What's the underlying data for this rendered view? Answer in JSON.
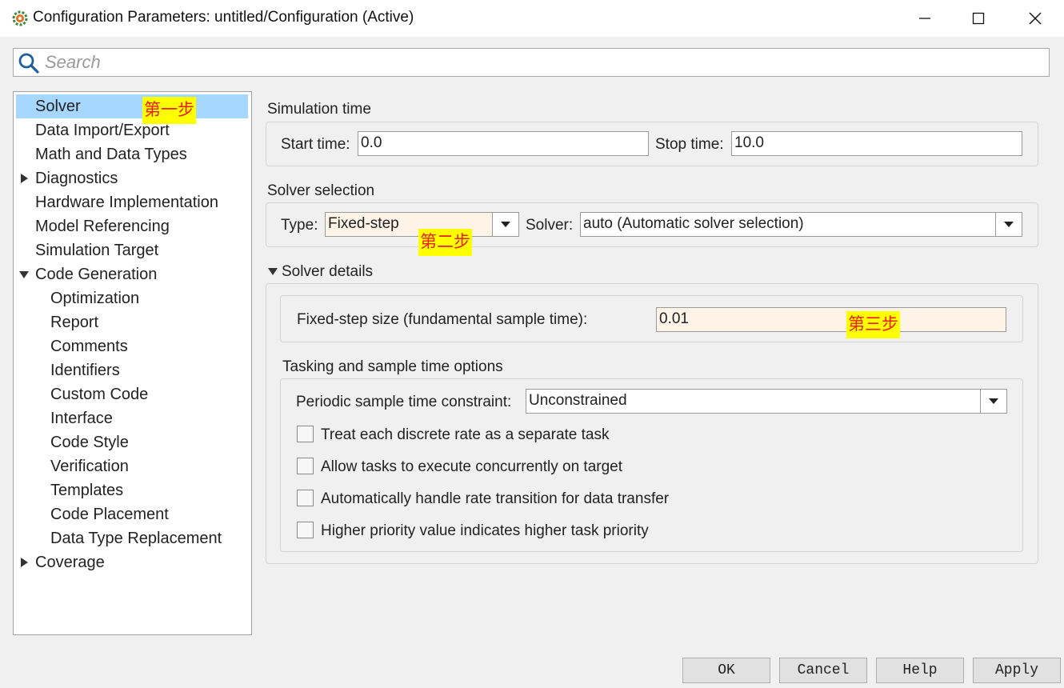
{
  "window": {
    "title": "Configuration Parameters: untitled/Configuration (Active)",
    "icon": "gear-cog-icon"
  },
  "search": {
    "placeholder": "Search",
    "value": ""
  },
  "tree": {
    "items": [
      {
        "label": "Solver",
        "selected": true
      },
      {
        "label": "Data Import/Export"
      },
      {
        "label": "Math and Data Types"
      },
      {
        "label": "Diagnostics",
        "expander": "collapsed"
      },
      {
        "label": "Hardware Implementation"
      },
      {
        "label": "Model Referencing"
      },
      {
        "label": "Simulation Target"
      },
      {
        "label": "Code Generation",
        "expander": "expanded"
      },
      {
        "label": "Optimization"
      },
      {
        "label": "Report"
      },
      {
        "label": "Comments"
      },
      {
        "label": "Identifiers"
      },
      {
        "label": "Custom Code"
      },
      {
        "label": "Interface"
      },
      {
        "label": "Code Style"
      },
      {
        "label": "Verification"
      },
      {
        "label": "Templates"
      },
      {
        "label": "Code Placement"
      },
      {
        "label": "Data Type Replacement"
      },
      {
        "label": "Coverage",
        "expander": "collapsed"
      }
    ]
  },
  "annotations": {
    "step1": "第一步",
    "step2": "第二步",
    "step3": "第三步"
  },
  "simulation_time": {
    "heading": "Simulation time",
    "start_label": "Start time:",
    "start_value": "0.0",
    "stop_label": "Stop time:",
    "stop_value": "10.0"
  },
  "solver_selection": {
    "heading": "Solver selection",
    "type_label": "Type:",
    "type_value": "Fixed-step",
    "solver_label": "Solver:",
    "solver_value": "auto (Automatic solver selection)"
  },
  "solver_details": {
    "heading": "Solver details",
    "fixed_step_label": "Fixed-step size (fundamental sample time):",
    "fixed_step_value": "0.01"
  },
  "tasking": {
    "heading": "Tasking and sample time options",
    "periodic_label": "Periodic sample time constraint:",
    "periodic_value": "Unconstrained",
    "checkboxes": [
      {
        "label": "Treat each discrete rate as a separate task",
        "checked": false
      },
      {
        "label": "Allow tasks to execute concurrently on target",
        "checked": false
      },
      {
        "label": "Automatically handle rate transition for data transfer",
        "checked": false
      },
      {
        "label": "Higher priority value indicates higher task priority",
        "checked": false
      }
    ]
  },
  "buttons": {
    "ok": "OK",
    "cancel": "Cancel",
    "help": "Help",
    "apply": "Apply"
  },
  "colors": {
    "selection": "#a6d8ff",
    "sticker_bg": "#ffff00",
    "sticker_text": "#e8201a",
    "tinted_field": "#fdf3e7"
  }
}
